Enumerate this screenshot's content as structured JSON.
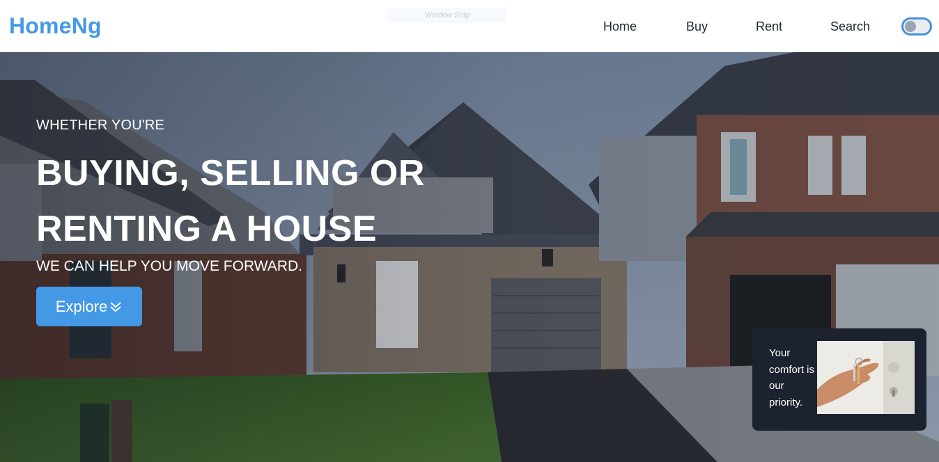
{
  "header": {
    "logo": "HomeNg",
    "window_snip": "Window Snip",
    "nav": [
      "Home",
      "Buy",
      "Rent",
      "Search"
    ],
    "theme_toggle": "off"
  },
  "hero": {
    "eyebrow": "WHETHER YOU'RE",
    "headline_line1": "BUYING, SELLING OR",
    "headline_line2": "RENTING A HOUSE",
    "subline": "WE CAN HELP YOU MOVE FORWARD.",
    "explore_label": "Explore"
  },
  "card": {
    "text": "Your comfort is our priority."
  },
  "colors": {
    "accent": "#4499e6",
    "card_bg": "#1d2230",
    "text_dark": "#1f2630"
  }
}
